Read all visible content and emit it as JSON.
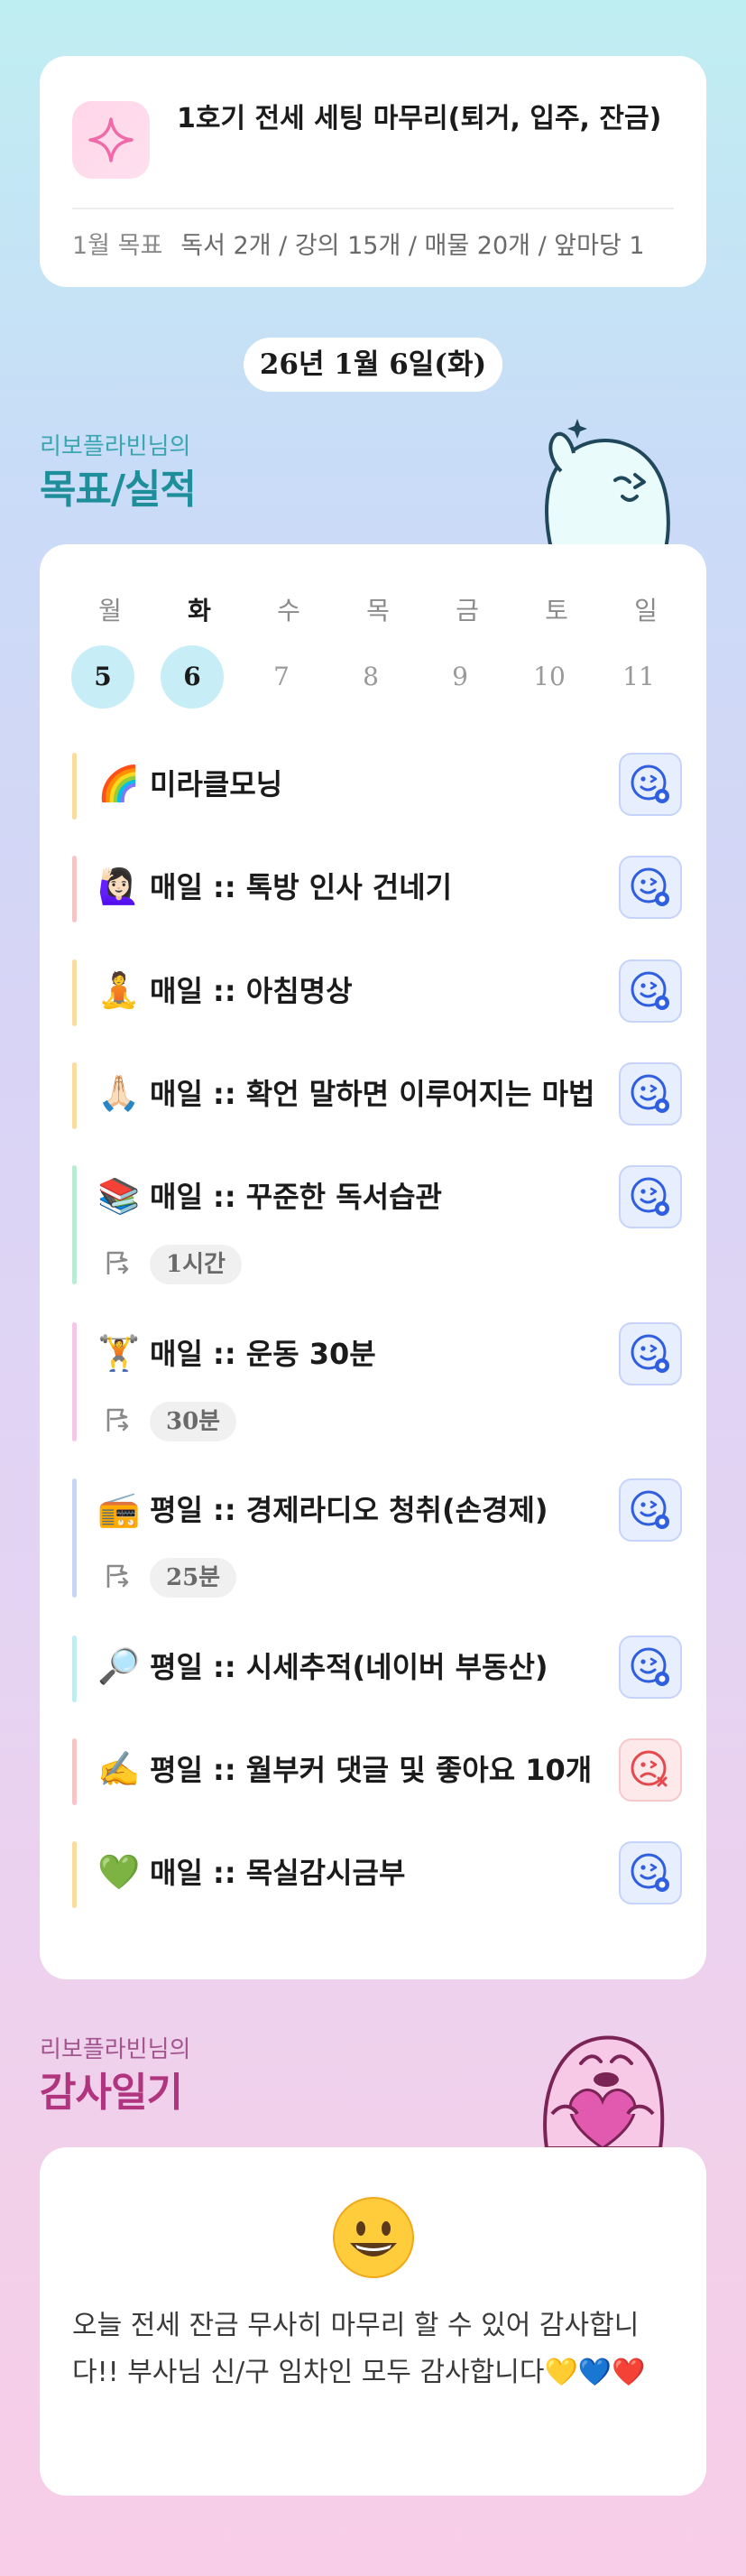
{
  "goal": {
    "title": "1호기 전세 세팅 마무리(퇴거, 입주, 잔금)",
    "month_label": "1월 목표",
    "month_summary": "독서 2개 / 강의 15개 / 매물 20개 / 앞마당 1"
  },
  "date_label": "26년 1월 6일(화)",
  "goals_section": {
    "subtitle": "리보플라빈님의",
    "title": "목표/실적"
  },
  "week": {
    "days": [
      "월",
      "화",
      "수",
      "목",
      "금",
      "토",
      "일"
    ],
    "dates": [
      "5",
      "6",
      "7",
      "8",
      "9",
      "10",
      "11"
    ],
    "today_index": 1,
    "active_dates": [
      0,
      1
    ]
  },
  "items": [
    {
      "emoji": "🌈",
      "label": "미라클모닝",
      "status": "done",
      "bar_color": "#fbdca0"
    },
    {
      "emoji": "🙋🏻‍♀️",
      "label": "매일 :: 톡방 인사 건네기",
      "status": "done",
      "bar_color": "#f8c5c5"
    },
    {
      "emoji": "🧘",
      "label": "매일 :: 아침명상",
      "status": "done",
      "bar_color": "#fbdca0"
    },
    {
      "emoji": "🙏🏻",
      "label": "매일 :: 확언 말하면 이루어지는 마법",
      "status": "done",
      "bar_color": "#fbdca0"
    },
    {
      "emoji": "📚",
      "label": "매일 :: 꾸준한 독서습관",
      "status": "done",
      "bar_color": "#b9ecd3",
      "time": "1시간"
    },
    {
      "emoji": "🏋️",
      "label": "매일 :: 운동 30분",
      "status": "done",
      "bar_color": "#f5c7e6",
      "time": "30분"
    },
    {
      "emoji": "📻",
      "label": "평일 :: 경제라디오 청취(손경제)",
      "status": "done",
      "bar_color": "#c9d5f7",
      "time": "25분"
    },
    {
      "emoji": "🔎",
      "label": "평일 :: 시세추적(네이버 부동산)",
      "status": "done",
      "bar_color": "#bfeef2"
    },
    {
      "emoji": "✍️",
      "label": "평일 :: 월부커 댓글 및 좋아요 10개",
      "status": "fail",
      "bar_color": "#f8c5c5"
    },
    {
      "emoji": "💚",
      "label": "매일 :: 목실감시금부",
      "status": "done",
      "bar_color": "#fbdca0"
    }
  ],
  "gratitude_section": {
    "subtitle": "리보플라빈님의",
    "title": "감사일기"
  },
  "gratitude": {
    "text": "오늘 전세 잔금 무사히 마무리 할 수 있어 감사합니다!! 부사님 신/구 임차인 모두 감사합니다💛💙❤️"
  },
  "colors": {
    "accent_blue": "#2f5fe0",
    "fail_red": "#e5484d",
    "section_teal": "#3aa6b1",
    "section_pink": "#b0357e"
  }
}
